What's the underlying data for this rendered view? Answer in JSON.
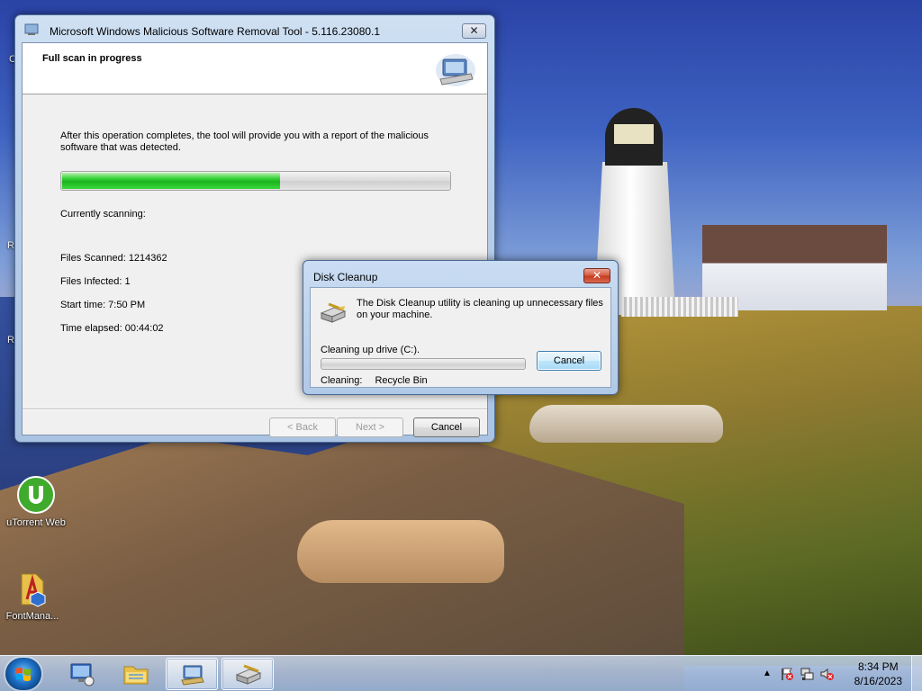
{
  "desktop": {
    "icons": [
      {
        "label": "uTorrent Web",
        "icon": "utorrent-icon"
      },
      {
        "label": "FontMana...",
        "icon": "font-manager-icon"
      }
    ],
    "edge_labels": [
      "C",
      "R",
      "R"
    ]
  },
  "msrt": {
    "title": "Microsoft Windows Malicious Software Removal Tool - 5.116.23080.1",
    "close_label": "✕",
    "header_title": "Full scan in progress",
    "description": "After this operation completes, the tool will provide you with a report of the malicious software that was detected.",
    "progress_percent": 56,
    "currently_scanning": "Currently scanning:",
    "files_scanned": "Files Scanned: 1214362",
    "files_infected": "Files Infected: 1",
    "start_time": "Start time: 7:50 PM",
    "time_elapsed": "Time elapsed: 00:44:02",
    "back_label": "< Back",
    "next_label": "Next >",
    "cancel_label": "Cancel",
    "header_icon": "msrt-scan-icon"
  },
  "disk_cleanup": {
    "title": "Disk Cleanup",
    "close_label": "✕",
    "message": "The Disk Cleanup utility is cleaning up unnecessary files on your machine.",
    "drive_label": "Cleaning up drive  (C:).",
    "progress_percent": 0,
    "cancel_label": "Cancel",
    "cleaning_label": "Cleaning:",
    "cleaning_target": "Recycle Bin",
    "icon": "disk-cleanup-icon"
  },
  "taskbar": {
    "items": [
      {
        "name": "remote-desktop",
        "icon": "monitor-icon",
        "active": false
      },
      {
        "name": "windows-explorer",
        "icon": "folder-icon",
        "active": false
      },
      {
        "name": "msrt",
        "icon": "msrt-icon",
        "active": true
      },
      {
        "name": "disk-cleanup",
        "icon": "disk-cleanup-icon",
        "active": true
      }
    ],
    "time": "8:34 PM",
    "date": "8/16/2023",
    "tray_icons": [
      "show-hidden-icons",
      "action-center-flag-icon",
      "network-icon",
      "volume-muted-icon"
    ]
  }
}
